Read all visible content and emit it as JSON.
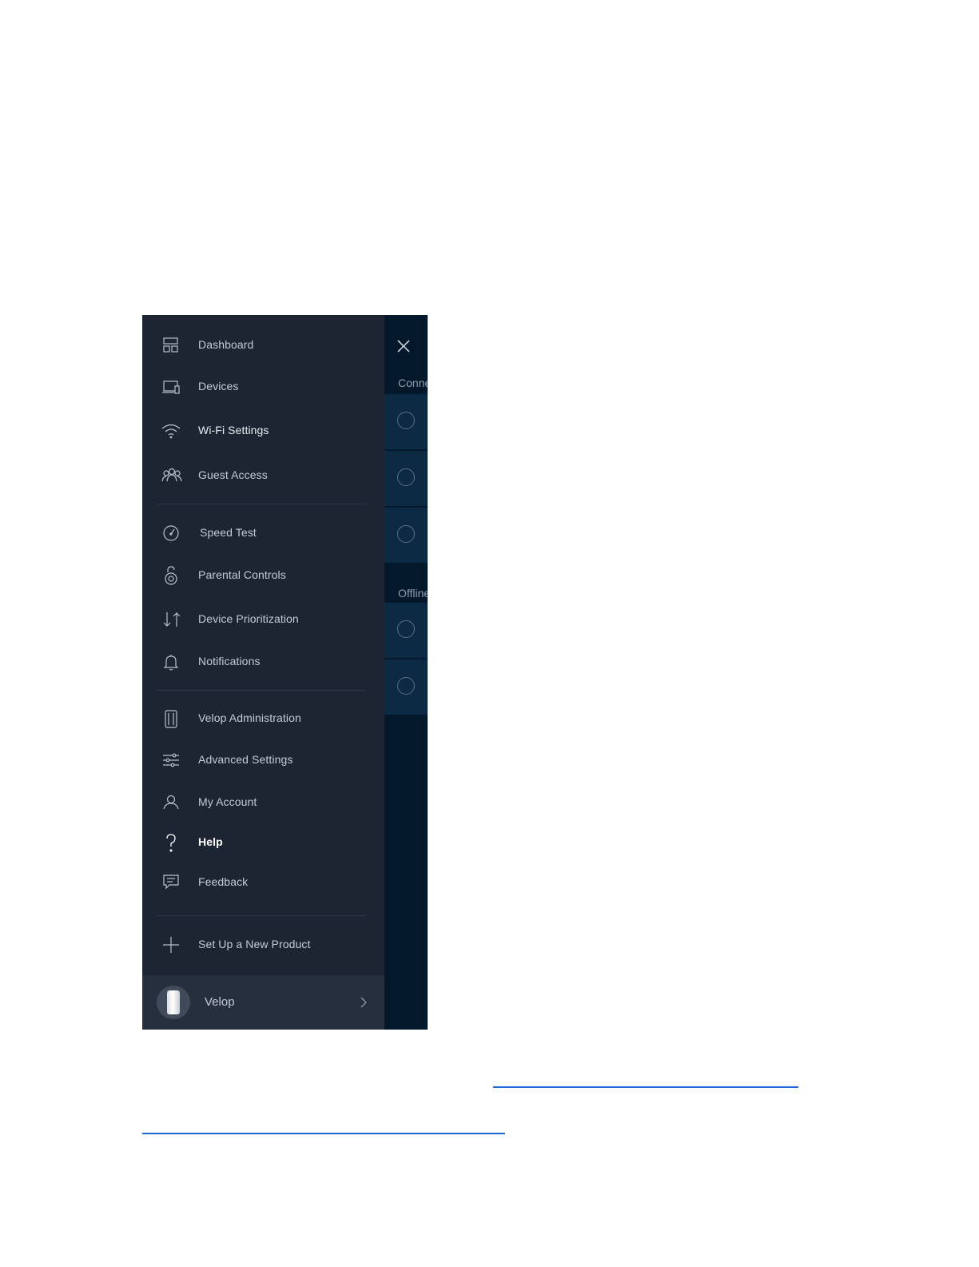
{
  "drawer": {
    "items": [
      {
        "label": "Dashboard",
        "icon": "dashboard-icon"
      },
      {
        "label": "Devices",
        "icon": "devices-icon"
      },
      {
        "label": "Wi-Fi Settings",
        "icon": "wifi-icon"
      },
      {
        "label": "Guest Access",
        "icon": "guest-access-icon"
      },
      {
        "label": "Speed Test",
        "icon": "speedometer-icon"
      },
      {
        "label": "Parental Controls",
        "icon": "lock-icon"
      },
      {
        "label": "Device Prioritization",
        "icon": "priority-arrows-icon"
      },
      {
        "label": "Notifications",
        "icon": "bell-icon"
      },
      {
        "label": "Velop Administration",
        "icon": "velop-node-icon"
      },
      {
        "label": "Advanced Settings",
        "icon": "sliders-icon"
      },
      {
        "label": "My Account",
        "icon": "user-icon"
      },
      {
        "label": "Help",
        "icon": "question-icon"
      },
      {
        "label": "Feedback",
        "icon": "chat-icon"
      },
      {
        "label": "Set Up a New Product",
        "icon": "plus-icon"
      }
    ],
    "footer": {
      "name": "Velop",
      "icon": "chevron-right-icon"
    }
  },
  "background_panel": {
    "section_connected": "Conne",
    "section_offline": "Offline",
    "close_icon": "close-icon"
  },
  "colors": {
    "drawer": "#1d2533",
    "background": "#04182b",
    "link": "#1d67d8"
  }
}
